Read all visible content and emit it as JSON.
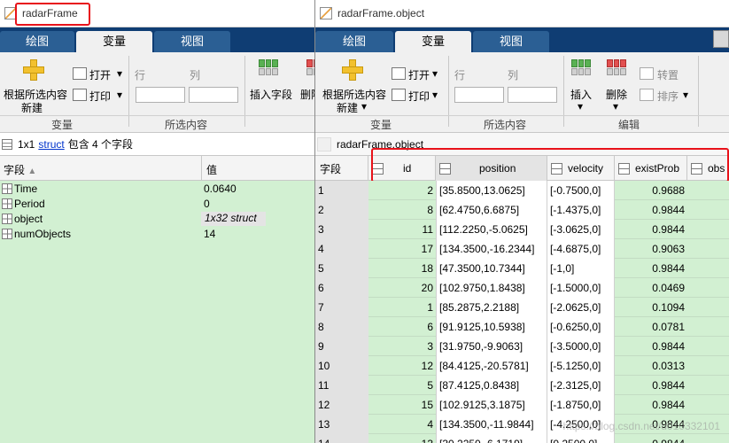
{
  "left": {
    "title": "radarFrame",
    "tabs": [
      "绘图",
      "变量",
      "视图"
    ],
    "active_tab": 1,
    "toolbar": {
      "new_from_selection": "根据所选内容",
      "new_label": "新建",
      "open": "打开",
      "print": "打印",
      "row": "行",
      "col": "列",
      "insert_field": "插入字段",
      "delete": "删除",
      "group_variable": "变量",
      "group_selection": "所选内容"
    },
    "info": {
      "size": "1x1",
      "type": "struct",
      "rest": "包含 4 个字段"
    },
    "table": {
      "headers": [
        "字段",
        "值"
      ],
      "rows": [
        {
          "field": "Time",
          "value": "0.0640"
        },
        {
          "field": "Period",
          "value": "0"
        },
        {
          "field": "object",
          "value": "1x32 struct"
        },
        {
          "field": "numObjects",
          "value": "14"
        }
      ]
    }
  },
  "right": {
    "title": "radarFrame.object",
    "tabs": [
      "绘图",
      "变量",
      "视图"
    ],
    "active_tab": 1,
    "toolbar": {
      "new_from_selection": "根据所选内容",
      "new_label": "新建",
      "open": "打开",
      "print": "打印",
      "row": "行",
      "col": "列",
      "insert": "插入",
      "delete": "删除",
      "transpose": "转置",
      "sort": "排序",
      "group_variable": "变量",
      "group_selection": "所选内容",
      "group_edit": "编辑"
    },
    "info": "radarFrame.object",
    "table": {
      "headers": [
        "字段",
        "id",
        "position",
        "velocity",
        "existProb",
        "obs"
      ],
      "rows": [
        {
          "n": "1",
          "id": "2",
          "position": "[35.8500,13.0625]",
          "velocity": "[-0.7500,0]",
          "existProb": "0.9688"
        },
        {
          "n": "2",
          "id": "8",
          "position": "[62.4750,6.6875]",
          "velocity": "[-1.4375,0]",
          "existProb": "0.9844"
        },
        {
          "n": "3",
          "id": "11",
          "position": "[112.2250,-5.0625]",
          "velocity": "[-3.0625,0]",
          "existProb": "0.9844"
        },
        {
          "n": "4",
          "id": "17",
          "position": "[134.3500,-16.2344]",
          "velocity": "[-4.6875,0]",
          "existProb": "0.9063"
        },
        {
          "n": "5",
          "id": "18",
          "position": "[47.3500,10.7344]",
          "velocity": "[-1,0]",
          "existProb": "0.9844"
        },
        {
          "n": "6",
          "id": "20",
          "position": "[102.9750,1.8438]",
          "velocity": "[-1.5000,0]",
          "existProb": "0.0469"
        },
        {
          "n": "7",
          "id": "1",
          "position": "[85.2875,2.2188]",
          "velocity": "[-2.0625,0]",
          "existProb": "0.1094"
        },
        {
          "n": "8",
          "id": "6",
          "position": "[91.9125,10.5938]",
          "velocity": "[-0.6250,0]",
          "existProb": "0.0781"
        },
        {
          "n": "9",
          "id": "3",
          "position": "[31.9750,-9.9063]",
          "velocity": "[-3.5000,0]",
          "existProb": "0.9844"
        },
        {
          "n": "10",
          "id": "12",
          "position": "[84.4125,-20.5781]",
          "velocity": "[-5.1250,0]",
          "existProb": "0.0313"
        },
        {
          "n": "11",
          "id": "5",
          "position": "[87.4125,0.8438]",
          "velocity": "[-2.3125,0]",
          "existProb": "0.9844"
        },
        {
          "n": "12",
          "id": "15",
          "position": "[102.9125,3.1875]",
          "velocity": "[-1.8750,0]",
          "existProb": "0.9844"
        },
        {
          "n": "13",
          "id": "4",
          "position": "[134.3500,-11.9844]",
          "velocity": "[-4.2500,0]",
          "existProb": "0.9844"
        },
        {
          "n": "14",
          "id": "13",
          "position": "[30.2250,-6.1719]",
          "velocity": "[0.2500,0]",
          "existProb": "0.9844"
        }
      ]
    },
    "watermark": "https://blog.csdn.net/u010332101"
  },
  "colors": {
    "tab_strip": "#0f3d73",
    "table_green": "#d2f0d2",
    "highlight_red": "#e8121a",
    "link_blue": "#0033cc"
  }
}
